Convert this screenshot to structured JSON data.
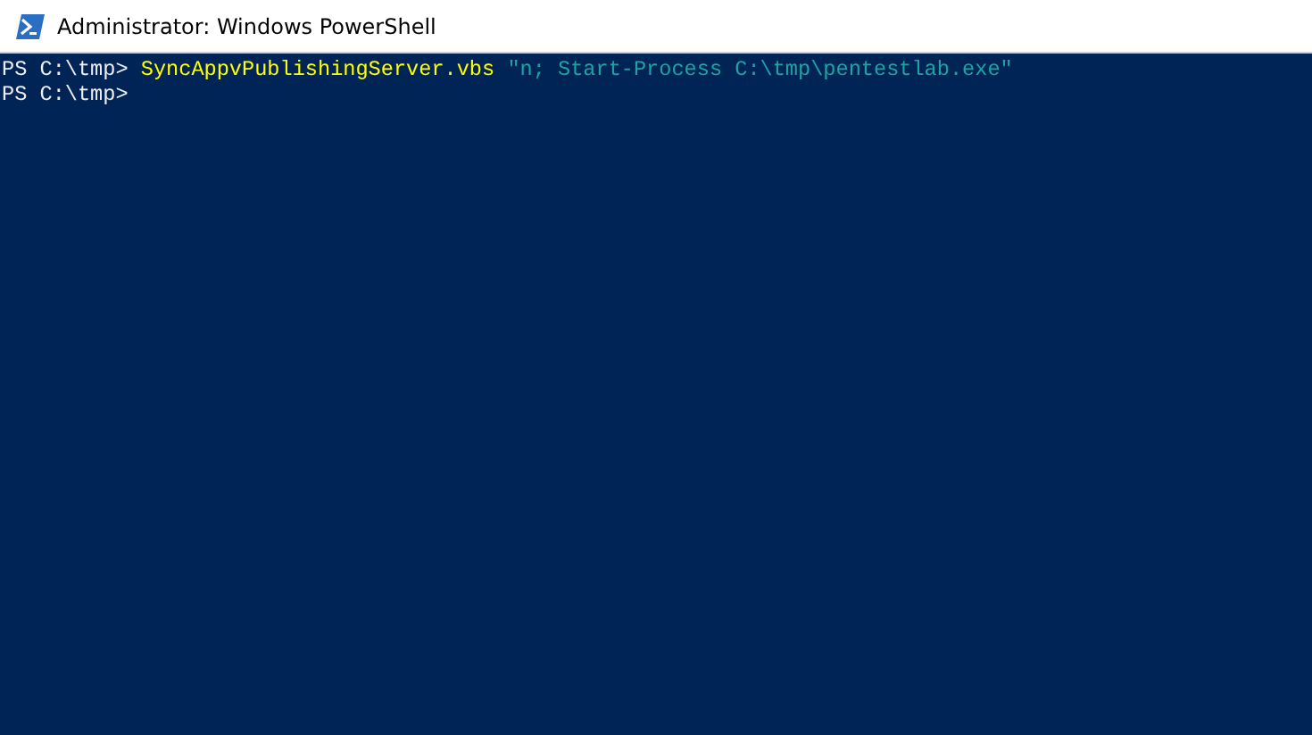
{
  "window": {
    "title": "Administrator: Windows PowerShell"
  },
  "console": {
    "lines": [
      {
        "segments": [
          {
            "kind": "prompt",
            "text": "PS C:\\tmp> "
          },
          {
            "kind": "command",
            "text": "SyncAppvPublishingServer.vbs"
          },
          {
            "kind": "string",
            "text": " \"n; Start-Process C:\\tmp\\pentestlab.exe\""
          }
        ]
      },
      {
        "segments": [
          {
            "kind": "prompt",
            "text": "PS C:\\tmp>"
          }
        ]
      }
    ]
  }
}
